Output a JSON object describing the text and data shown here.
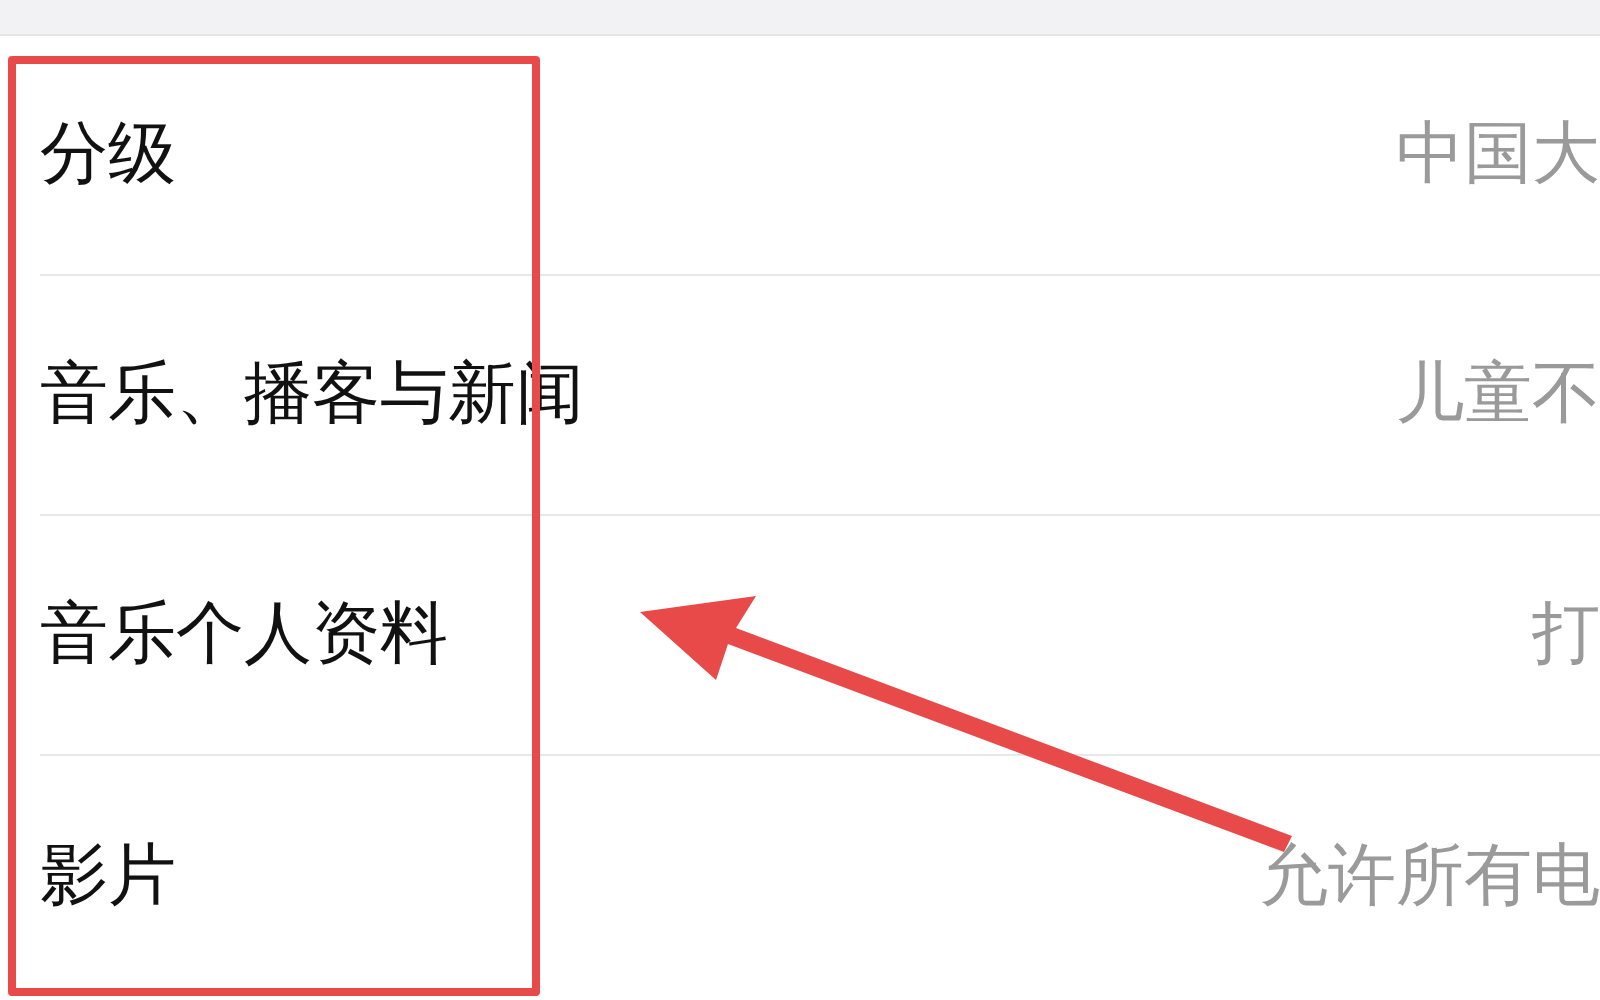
{
  "rows": [
    {
      "label": "分级",
      "value": "中国大"
    },
    {
      "label": "音乐、播客与新闻",
      "value": "儿童不"
    },
    {
      "label": "音乐个人资料",
      "value": "打"
    },
    {
      "label": "影片",
      "value": "允许所有电"
    }
  ]
}
